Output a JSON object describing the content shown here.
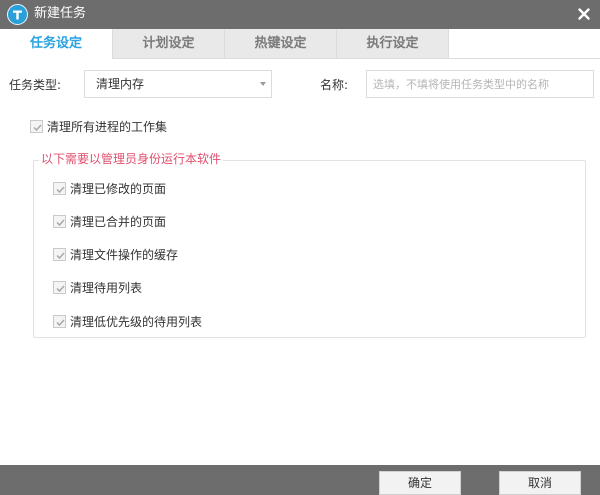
{
  "window": {
    "title": "新建任务"
  },
  "tabs": [
    {
      "label": "任务设定",
      "active": true
    },
    {
      "label": "计划设定",
      "active": false
    },
    {
      "label": "热键设定",
      "active": false
    },
    {
      "label": "执行设定",
      "active": false
    }
  ],
  "form": {
    "task_type_label": "任务类型:",
    "task_type_value": "清理内存",
    "name_label": "名称:",
    "name_value": "",
    "name_placeholder": "选填，不填将使用任务类型中的名称"
  },
  "options": {
    "main_checkbox": {
      "label": "清理所有进程的工作集",
      "checked": true
    },
    "admin_group_title": "以下需要以管理员身份运行本软件",
    "admin_items": [
      {
        "label": "清理已修改的页面",
        "checked": true
      },
      {
        "label": "清理已合并的页面",
        "checked": true
      },
      {
        "label": "清理文件操作的缓存",
        "checked": true
      },
      {
        "label": "清理待用列表",
        "checked": true
      },
      {
        "label": "清理低优先级的待用列表",
        "checked": true
      }
    ]
  },
  "footer": {
    "confirm_label": "确定",
    "cancel_label": "取消"
  },
  "colors": {
    "titlebar": "#6d6d6d",
    "active_tab": "#2aa3e0",
    "group_title": "#e0506e",
    "logo": "#2a9fd8"
  },
  "icons": {
    "app_logo": "app-logo-icon",
    "close": "close-icon",
    "dropdown": "dropdown-arrow-icon",
    "check": "check-icon"
  }
}
